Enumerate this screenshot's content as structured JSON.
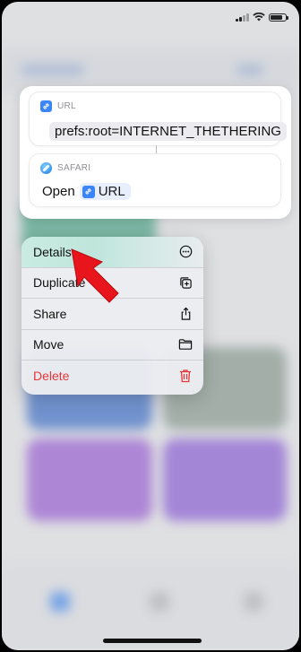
{
  "shortcut_card": {
    "url_action": {
      "header": "URL",
      "value": "prefs:root=INTERNET_THETHERING"
    },
    "safari_action": {
      "header": "SAFARI",
      "verb": "Open",
      "token": "URL"
    }
  },
  "context_menu": {
    "items": [
      {
        "label": "Details",
        "icon": "ellipsis-circle-icon"
      },
      {
        "label": "Duplicate",
        "icon": "plus-square-on-square-icon"
      },
      {
        "label": "Share",
        "icon": "share-icon"
      },
      {
        "label": "Move",
        "icon": "folder-icon"
      },
      {
        "label": "Delete",
        "icon": "trash-icon"
      }
    ]
  },
  "colors": {
    "accent": "#3c85f6",
    "destructive": "#e5363a",
    "pointer": "#e8161c"
  }
}
